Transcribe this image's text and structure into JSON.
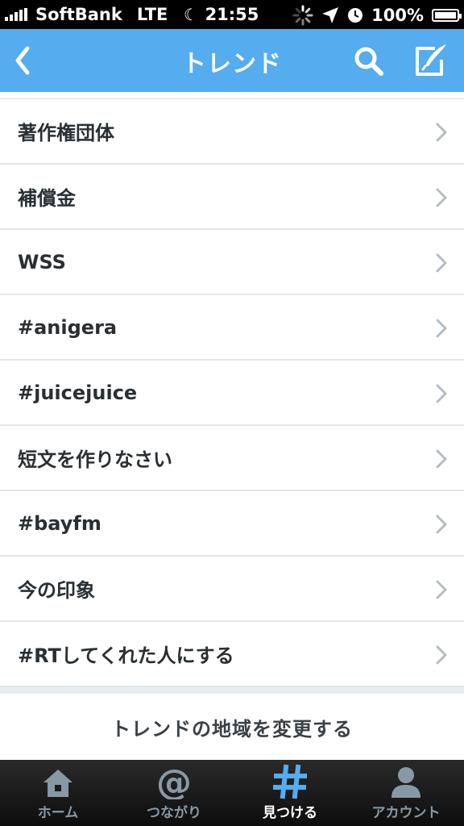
{
  "status_bar": {
    "carrier": "SoftBank",
    "network": "LTE",
    "time": "21:55",
    "battery": "100%"
  },
  "nav": {
    "title": "トレンド"
  },
  "trends": [
    {
      "label": "著作権団体"
    },
    {
      "label": "補償金"
    },
    {
      "label": "WSS"
    },
    {
      "label": "#anigera"
    },
    {
      "label": "#juicejuice"
    },
    {
      "label": "短文を作りなさい"
    },
    {
      "label": "#bayfm"
    },
    {
      "label": "今の印象"
    },
    {
      "label": "#RTしてくれた人にする"
    }
  ],
  "change_region_label": "トレンドの地域を変更する",
  "tabs": [
    {
      "label": "ホーム",
      "icon": "home-icon",
      "active": false
    },
    {
      "label": "つながり",
      "icon": "at-icon",
      "active": false
    },
    {
      "label": "見つける",
      "icon": "hashtag-icon",
      "active": true
    },
    {
      "label": "アカウント",
      "icon": "person-icon",
      "active": false
    }
  ],
  "colors": {
    "accent": "#55acee",
    "tab_active_icon": "#55acee",
    "tab_inactive": "#8899a6"
  }
}
